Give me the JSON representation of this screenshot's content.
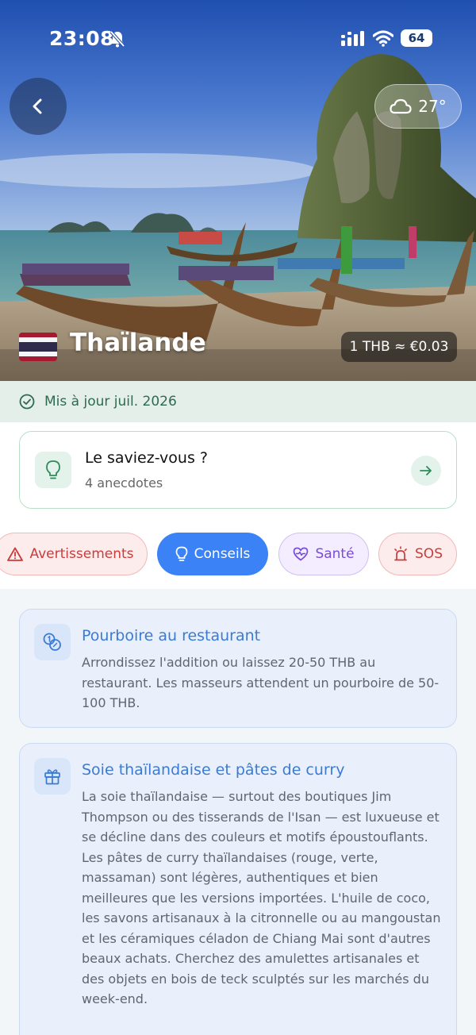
{
  "status": {
    "time": "23:08",
    "battery": "64"
  },
  "weather": {
    "temp": "27°",
    "icon": "cloud-icon"
  },
  "country": {
    "name": "Thaïlande",
    "rate": "1 THB ≈ €0.03"
  },
  "updated": "Mis à jour juil. 2026",
  "did_you_know": {
    "title": "Le saviez-vous ?",
    "subtitle": "4 anecdotes"
  },
  "tabs": [
    {
      "label": "Avertissements",
      "icon": "warning-icon",
      "color": "#cc3b3b"
    },
    {
      "label": "Conseils",
      "icon": "bulb-icon",
      "color": "#3b82f6",
      "active": true
    },
    {
      "label": "Santé",
      "icon": "heart-icon",
      "color": "#7a4bd8"
    },
    {
      "label": "SOS",
      "icon": "siren-icon",
      "color": "#cc3b3b"
    }
  ],
  "cards": [
    {
      "title": "Pourboire au restaurant",
      "icon": "coins-icon",
      "body": "Arrondissez l'addition ou laissez 20-50 THB au restaurant. Les masseurs attendent un pourboire de 50-100 THB."
    },
    {
      "title": "Soie thaïlandaise et pâtes de curry",
      "icon": "gift-icon",
      "body": "La soie thaïlandaise — surtout des boutiques Jim Thompson ou des tisserands de l'Isan — est luxueuse et se décline dans des couleurs et motifs époustouflants. Les pâtes de curry thaïlandaises (rouge, verte, massaman) sont légères, authentiques et bien meilleures que les versions importées. L'huile de coco, les savons artisanaux à la citronnelle ou au mangoustan et les céramiques céladon de Chiang Mai sont d'autres beaux achats. Cherchez des amulettes artisanales et des objets en bois de teck sculptés sur les marchés du week-end."
    }
  ]
}
